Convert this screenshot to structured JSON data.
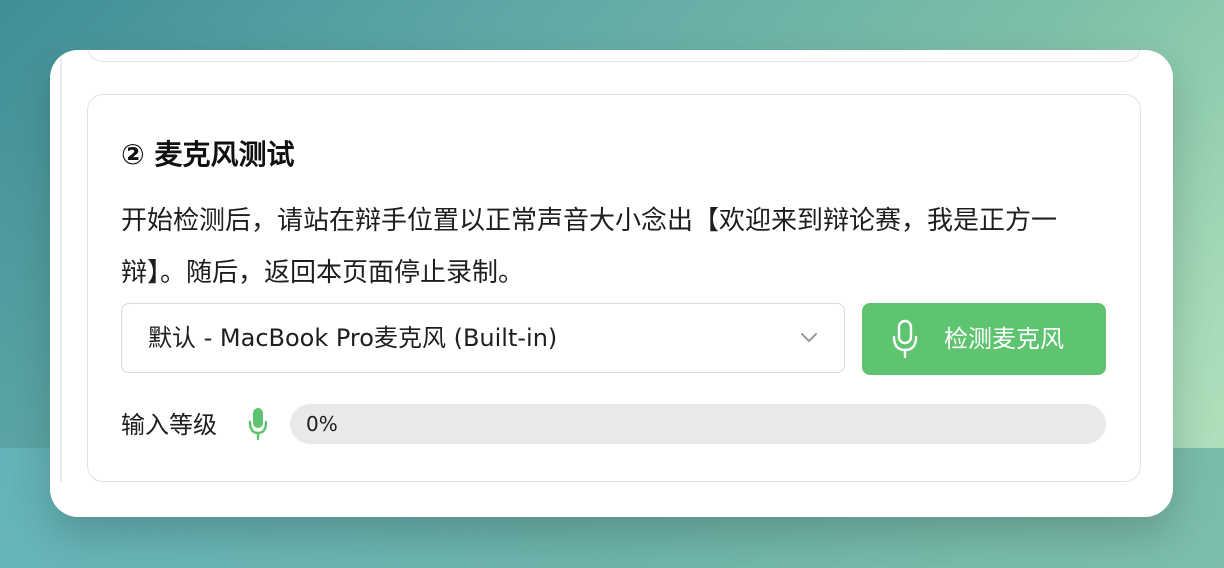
{
  "section": {
    "title": "② 麦克风测试",
    "description": "开始检测后，请站在辩手位置以正常声音大小念出【欢迎来到辩论赛，我是正方一辩】。随后，返回本页面停止录制。"
  },
  "device_select": {
    "value": "默认 - MacBook Pro麦克风 (Built-in)",
    "icon": "chevron-down-icon"
  },
  "detect_button": {
    "label": "检测麦克风",
    "icon": "microphone-icon",
    "color": "#5ec46f"
  },
  "input_level": {
    "label": "输入等级",
    "icon": "microphone-icon",
    "value_text": "0%",
    "value": 0
  }
}
